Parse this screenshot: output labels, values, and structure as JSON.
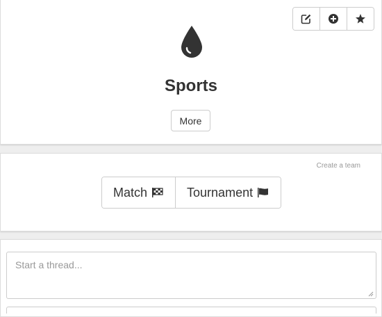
{
  "header_actions": [
    {
      "icon": "edit-icon",
      "glyph": "✎"
    },
    {
      "icon": "add-icon",
      "glyph": "⊕"
    },
    {
      "icon": "star-icon",
      "glyph": "★"
    }
  ],
  "hero": {
    "icon": "drop-icon",
    "title": "Sports",
    "more_label": "More"
  },
  "team": {
    "create_team_label": "Create a team",
    "options": [
      {
        "label": "Match",
        "flag": "🏁",
        "icon": "checkered-flag-icon"
      },
      {
        "label": "Tournament",
        "flag": "⚑",
        "icon": "flag-icon"
      }
    ]
  },
  "composer": {
    "placeholder": "Start a thread..."
  }
}
